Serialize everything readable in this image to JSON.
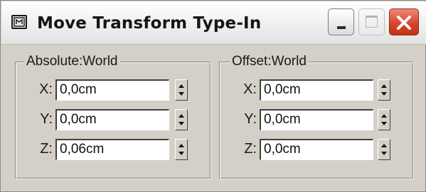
{
  "window": {
    "title": "Move Transform Type-In",
    "icon": "max-dialog-icon",
    "buttons": [
      "minimize",
      "maximize",
      "close"
    ]
  },
  "absolute": {
    "legend": "Absolute:World",
    "rows": [
      {
        "axis": "X:",
        "value": "0,0cm"
      },
      {
        "axis": "Y:",
        "value": "0,0cm"
      },
      {
        "axis": "Z:",
        "value": "0,06cm"
      }
    ]
  },
  "offset": {
    "legend": "Offset:World",
    "rows": [
      {
        "axis": "X:",
        "value": "0,0cm"
      },
      {
        "axis": "Y:",
        "value": "0,0cm"
      },
      {
        "axis": "Z:",
        "value": "0,0cm"
      }
    ]
  },
  "colors": {
    "dialog_bg": "#d4d0c8",
    "close_button": "#d8442c",
    "field_bg": "#ffffff"
  }
}
